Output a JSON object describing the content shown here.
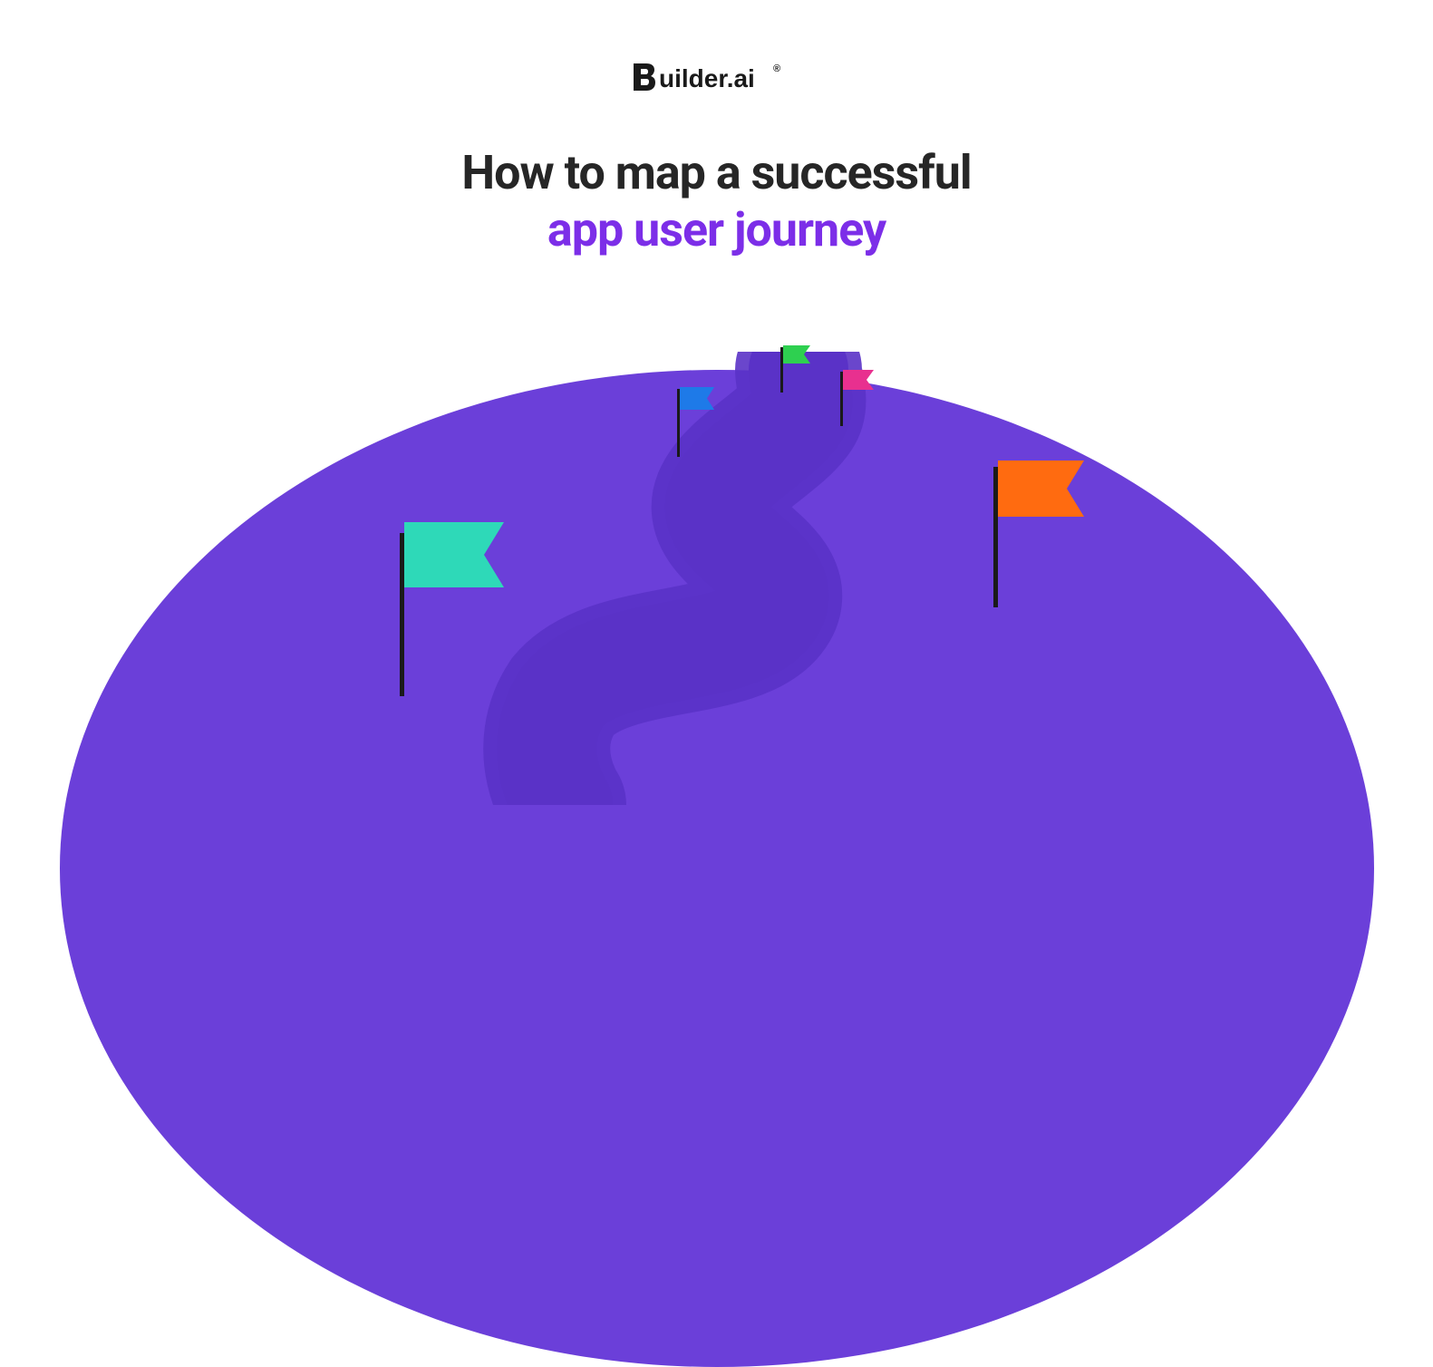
{
  "logo": {
    "brand": "Builder.ai",
    "registered": "®"
  },
  "title": {
    "line1": "How to map a successful",
    "line2": "app user journey"
  },
  "colors": {
    "hill_primary": "#6b3fd9",
    "hill_path": "#5a32c7",
    "title_accent": "#7c2ee8",
    "title_dark": "#262626",
    "flag_teal": "#2ed9b8",
    "flag_blue": "#1e7ae8",
    "flag_green": "#2ed050",
    "flag_pink": "#e8308f",
    "flag_orange": "#ff6b10"
  },
  "flags": [
    {
      "color": "teal",
      "semantic": "milestone-1"
    },
    {
      "color": "blue",
      "semantic": "milestone-2"
    },
    {
      "color": "green",
      "semantic": "milestone-3"
    },
    {
      "color": "pink",
      "semantic": "milestone-4"
    },
    {
      "color": "orange",
      "semantic": "milestone-5"
    }
  ]
}
